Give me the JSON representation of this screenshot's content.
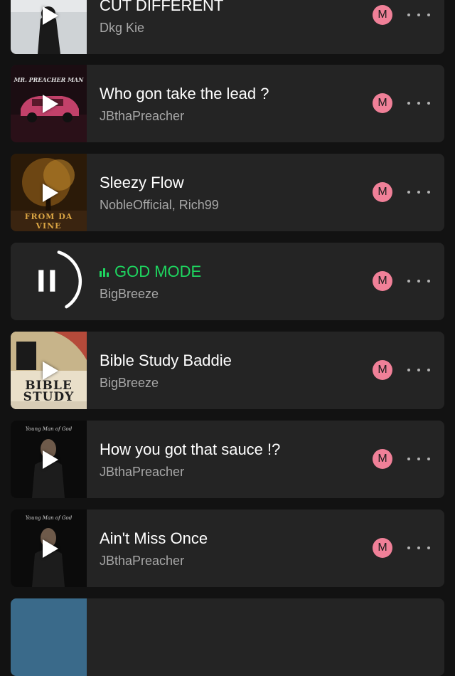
{
  "tracks": [
    {
      "title": "CUT DIFFERENT",
      "artist": "Dkg Kie",
      "badge": "M",
      "state": "idle"
    },
    {
      "title": "Who gon take the lead ?",
      "artist": "JBthaPreacher",
      "badge": "M",
      "state": "idle",
      "cover_text": "MR. PREACHER MAN"
    },
    {
      "title": "Sleezy Flow",
      "artist": "NobleOfficial, Rich99",
      "badge": "M",
      "state": "idle",
      "cover_text": "FROM DA VINE"
    },
    {
      "title": "GOD MODE",
      "artist": "BigBreeze",
      "badge": "M",
      "state": "playing"
    },
    {
      "title": "Bible Study Baddie",
      "artist": "BigBreeze",
      "badge": "M",
      "state": "idle",
      "cover_text": "BIBLE STUDY"
    },
    {
      "title": "How you got that sauce !?",
      "artist": "JBthaPreacher",
      "badge": "M",
      "state": "idle",
      "cover_text": "Young Man of God"
    },
    {
      "title": "Ain't Miss Once",
      "artist": "JBthaPreacher",
      "badge": "M",
      "state": "idle",
      "cover_text": "Young Man of God"
    }
  ],
  "colors": {
    "accent": "#1ed760",
    "badge": "#f08098",
    "card": "#242424",
    "background": "#121212"
  },
  "icons": {
    "play": "play-icon",
    "pause": "pause-icon",
    "more": "more-options-icon",
    "equalizer": "equalizer-icon"
  }
}
